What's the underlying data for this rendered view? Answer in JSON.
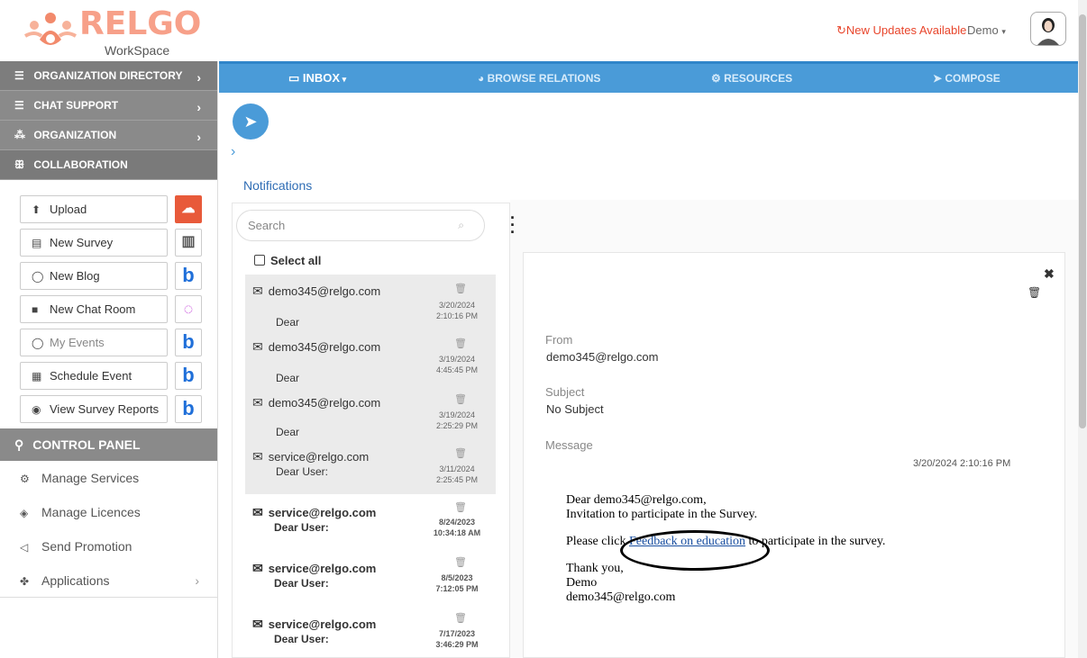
{
  "header": {
    "logo_text": "RELGO",
    "logo_sub": "WorkSpace",
    "updates_label": "New Updates Available",
    "user_name": "Demo"
  },
  "sidebar": {
    "sections": [
      {
        "label": "ORGANIZATION DIRECTORY",
        "icon": "list-icon"
      },
      {
        "label": "CHAT SUPPORT",
        "icon": "list-icon"
      },
      {
        "label": "ORGANIZATION",
        "icon": "org-chart-icon"
      },
      {
        "label": "COLLABORATION",
        "icon": "people-icon"
      }
    ],
    "tools": [
      {
        "label": "Upload",
        "icon": "upload-icon",
        "side_icon": "cloud-upload-icon"
      },
      {
        "label": "New Survey",
        "icon": "survey-icon",
        "side_icon": "document-icon"
      },
      {
        "label": "New Blog",
        "icon": "comment-icon",
        "side_icon": "b-icon"
      },
      {
        "label": "New Chat Room",
        "icon": "chat-icon",
        "side_icon": "chat-bubbles-icon"
      },
      {
        "label": "My Events",
        "icon": "comment-icon",
        "side_icon": "b-icon"
      },
      {
        "label": "Schedule Event",
        "icon": "calendar-icon",
        "side_icon": "b-icon"
      },
      {
        "label": "View Survey Reports",
        "icon": "eye-icon",
        "side_icon": "b-icon"
      }
    ],
    "b_glyph": "b",
    "control_panel": "CONTROL PANEL",
    "control_items": [
      {
        "label": "Manage Services",
        "icon": "gears-icon"
      },
      {
        "label": "Manage Licences",
        "icon": "tag-icon"
      },
      {
        "label": "Send Promotion",
        "icon": "megaphone-icon"
      },
      {
        "label": "Applications",
        "icon": "apps-icon"
      }
    ]
  },
  "topnav": {
    "inbox": "INBOX",
    "browse": "BROWSE RELATIONS",
    "resources": "RESOURCES",
    "compose": "COMPOSE"
  },
  "notifications_title": "Notifications",
  "search": {
    "placeholder": "Search"
  },
  "select_all": "Select all",
  "messages": [
    {
      "from": "demo345@relgo.com",
      "preview": "Dear",
      "date": "3/20/2024",
      "time": "2:10:16 PM",
      "read": true
    },
    {
      "from": "demo345@relgo.com",
      "preview": "Dear",
      "date": "3/19/2024",
      "time": "4:45:45 PM",
      "read": true
    },
    {
      "from": "demo345@relgo.com",
      "preview": "Dear",
      "date": "3/19/2024",
      "time": "2:25:29 PM",
      "read": true
    },
    {
      "from": "service@relgo.com",
      "preview": "Dear User:",
      "date": "3/11/2024",
      "time": "2:25:45 PM",
      "read": true
    },
    {
      "from": "service@relgo.com",
      "preview": "Dear User:",
      "date": "8/24/2023",
      "time": "10:34:18 AM",
      "read": false
    },
    {
      "from": "service@relgo.com",
      "preview": "Dear User:",
      "date": "8/5/2023",
      "time": "7:12:05 PM",
      "read": false
    },
    {
      "from": "service@relgo.com",
      "preview": "Dear User:",
      "date": "7/17/2023",
      "time": "3:46:29 PM",
      "read": false
    }
  ],
  "detail": {
    "from_label": "From",
    "from_value": "demo345@relgo.com",
    "subject_label": "Subject",
    "subject_value": "No Subject",
    "message_label": "Message",
    "timestamp": "3/20/2024 2:10:16 PM",
    "greeting": "Dear demo345@relgo.com,",
    "line1": "Invitation to participate in the Survey.",
    "line2_pre": "Please click ",
    "link_text": "Feedback on education",
    "line2_post": " to participate in the survey.",
    "thanks": "Thank you,",
    "sign_name": "Demo",
    "sign_email": "demo345@relgo.com"
  },
  "colors": {
    "nav_blue": "#4a9bd8",
    "sidebar_gray": "#8a8a8a",
    "update_red": "#e8452b",
    "logo_orange": "#f7a089"
  }
}
